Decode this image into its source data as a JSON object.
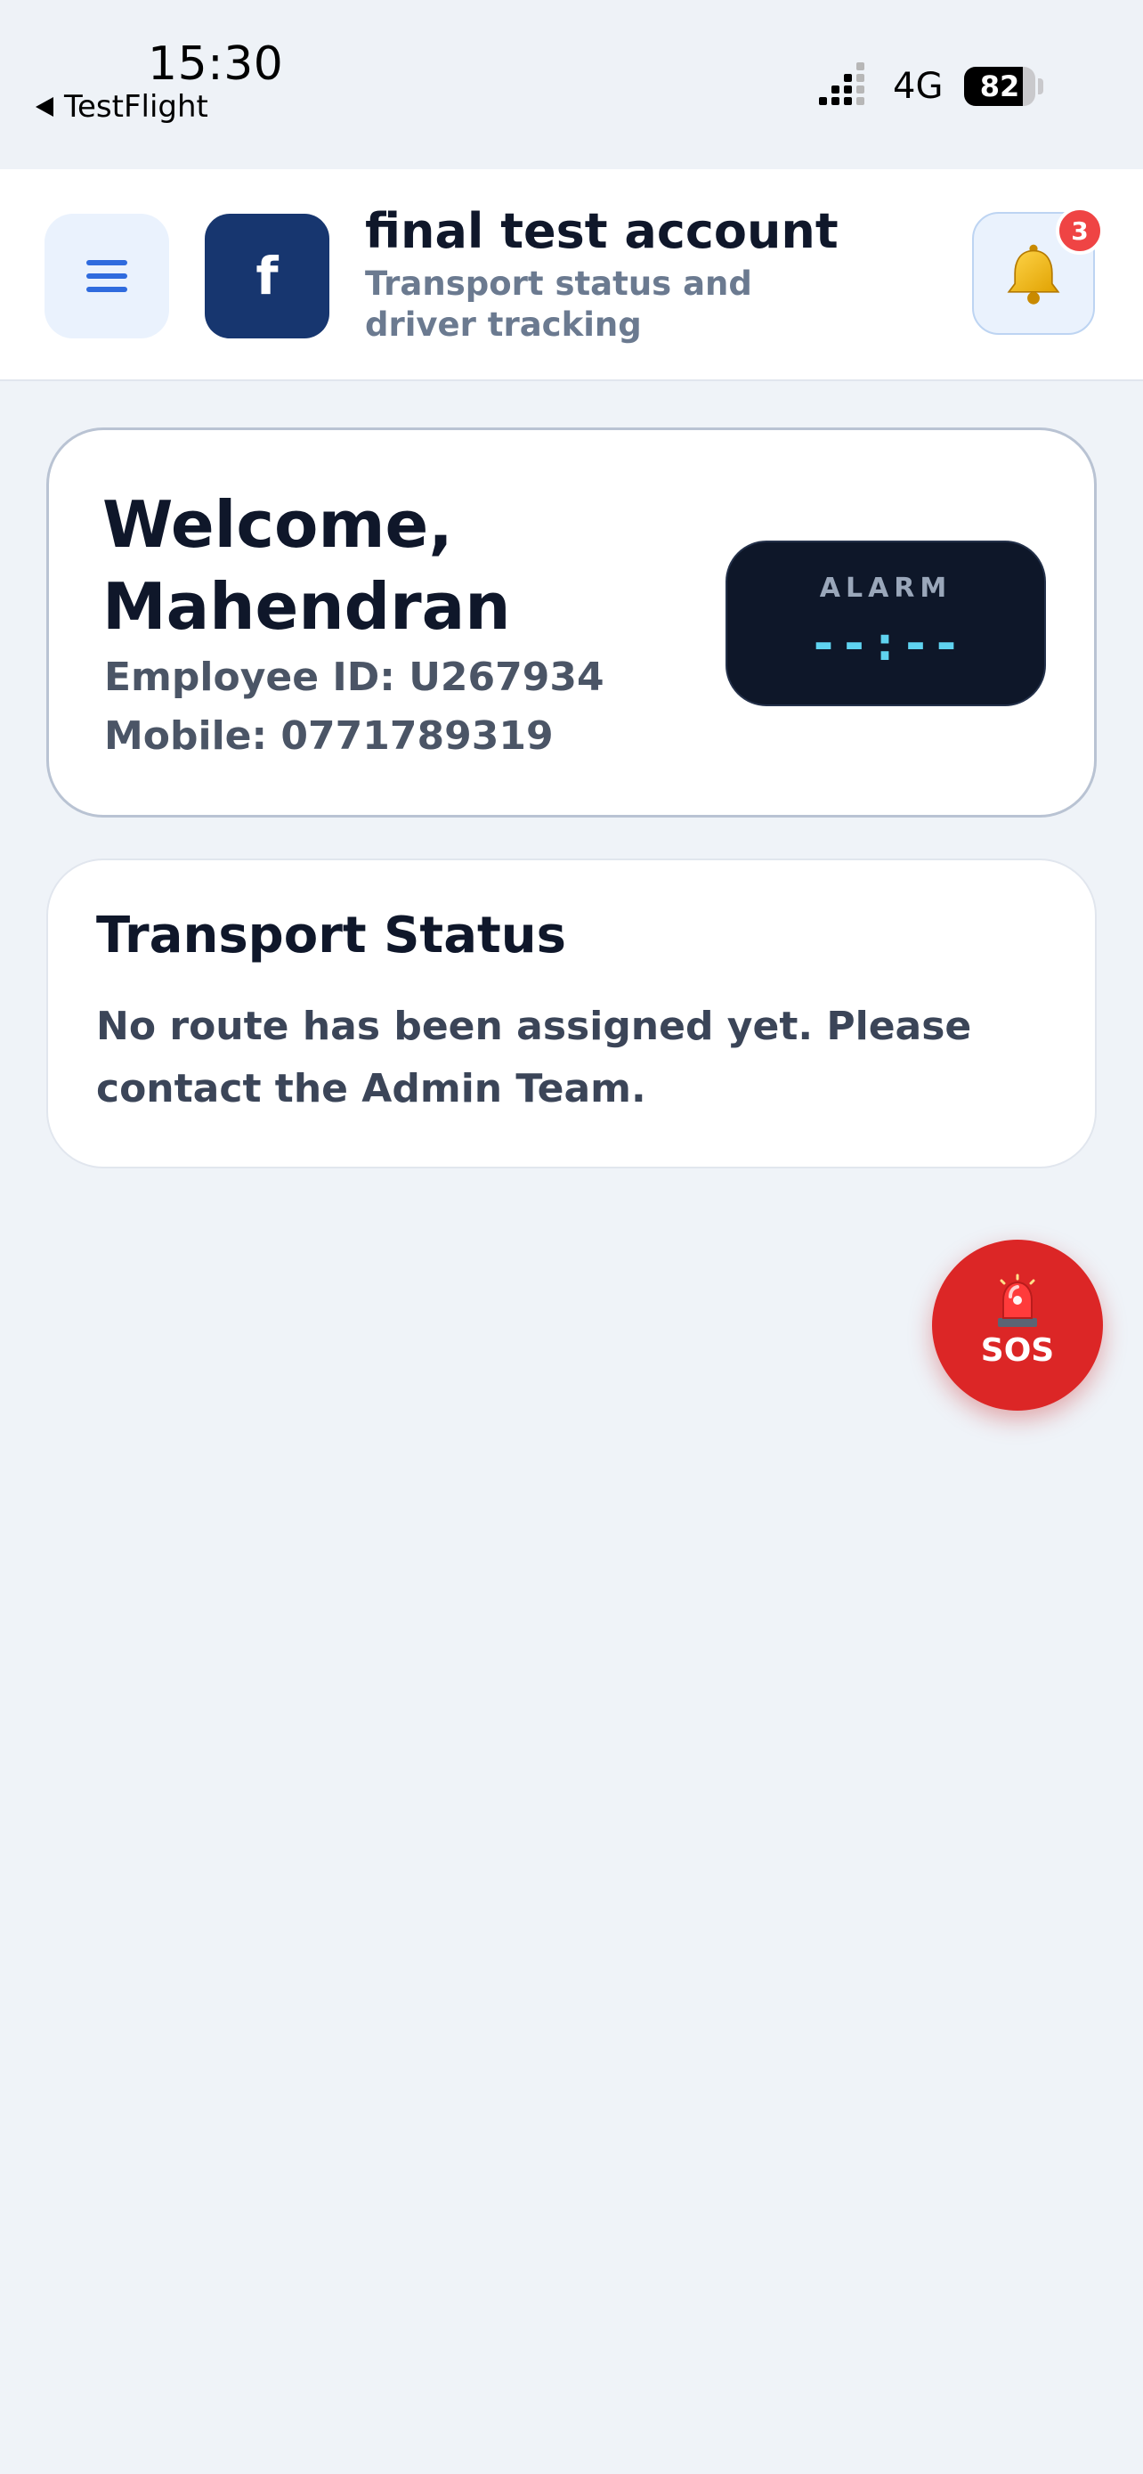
{
  "status_bar": {
    "time": "15:30",
    "back_app": "TestFlight",
    "network": "4G",
    "battery_percent": 82
  },
  "header": {
    "logo_letter": "f",
    "account_name": "final test account",
    "subtitle": "Transport status and driver tracking",
    "notification_count": "3",
    "icons": {
      "menu": "hamburger-menu-icon",
      "notifications": "bell-icon"
    }
  },
  "welcome": {
    "heading": "Welcome, Mahendran",
    "employee_id": "Employee ID: U267934",
    "mobile": "Mobile: 0771789319",
    "alarm_label": "ALARM",
    "alarm_time": "--:--"
  },
  "transport": {
    "title": "Transport Status",
    "message": "No route has been assigned yet. Please contact the Admin Team."
  },
  "sos": {
    "label": "SOS",
    "icon": "siren-icon"
  },
  "colors": {
    "background": "#eff3f8",
    "primary_blue": "#2f6bde",
    "logo_navy": "#17366f",
    "alarm_bg": "#0e1729",
    "alarm_digits": "#5fd3f0",
    "sos_red": "#dc2626",
    "badge_red": "#ef4444"
  }
}
